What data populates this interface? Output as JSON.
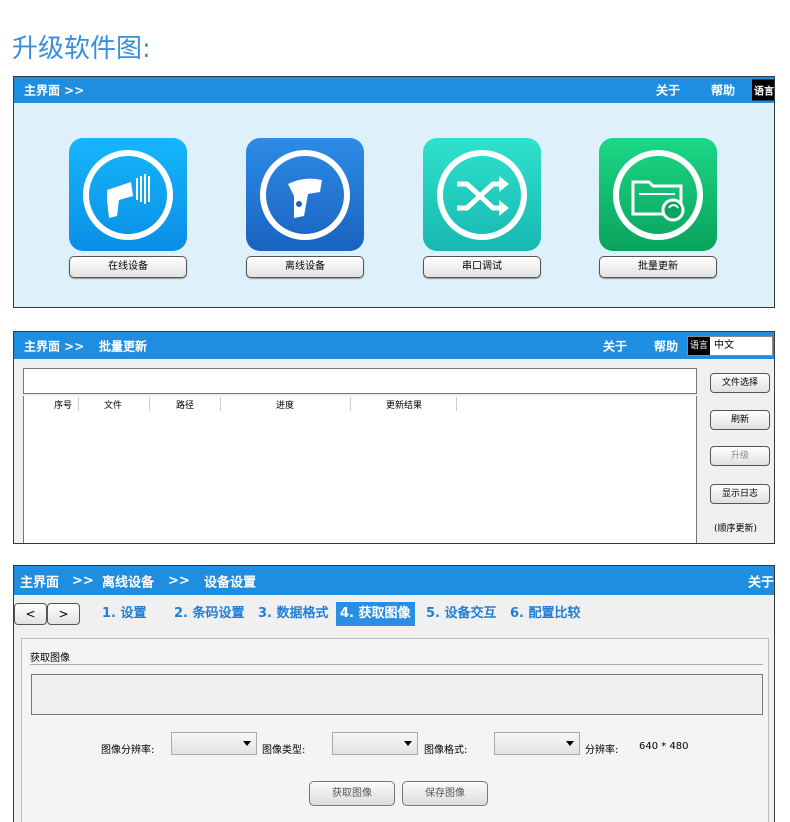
{
  "page_title": "升级软件图:",
  "panel1": {
    "header_left": "主界面 >>",
    "header_about": "关于",
    "header_help": "帮助",
    "header_lang": "语言",
    "apps": [
      {
        "label": "在线设备",
        "icon": "online-scanner-icon",
        "color_top": "#16b6fb",
        "color_bottom": "#0a8ee6"
      },
      {
        "label": "离线设备",
        "icon": "offline-scanner-icon",
        "color_top": "#2c8be6",
        "color_bottom": "#1a63c0"
      },
      {
        "label": "串口调试",
        "icon": "serial-shuffle-icon",
        "color_top": "#2fe2cd",
        "color_bottom": "#17b7b0"
      },
      {
        "label": "批量更新",
        "icon": "batch-update-folder-icon",
        "color_top": "#1cd787",
        "color_bottom": "#0aa25c"
      }
    ]
  },
  "panel2": {
    "header_left": "主界面 >>",
    "header_crumb": "批量更新",
    "header_about": "关于",
    "header_help": "帮助",
    "lang_label": "语言",
    "lang_value": "中文",
    "columns": [
      "序号",
      "文件",
      "路径",
      "进度",
      "更新结果"
    ],
    "buttons": {
      "choose_file": "文件选择",
      "refresh": "刷新",
      "upgrade": "升级",
      "show_log": "显示日志"
    },
    "sequence_note": "(顺序更新)"
  },
  "panel3": {
    "header_main": "主界面",
    "header_sep1": ">>",
    "header_offline": "离线设备",
    "header_sep2": ">>",
    "header_settings": "设备设置",
    "header_about": "关于",
    "nav_back": "<",
    "nav_forward": ">",
    "steps": [
      "1. 设置",
      "2. 条码设置",
      "3. 数据格式",
      "4. 获取图像",
      "5. 设备交互",
      "6. 配置比较"
    ],
    "section_title": "获取图像",
    "resolution_label": "图像分辨率:",
    "type_label": "图像类型:",
    "format_label": "图像格式:",
    "res_display_label": "分辨率:",
    "res_display_value": "640 * 480",
    "get_image_button": "获取图像",
    "save_image_button": "保存图像"
  },
  "colors": {
    "header_blue": "#1f8de0",
    "title_blue": "#3a8fdc",
    "panel1_bg": "#def1fb",
    "active_step": "#2a8fe4"
  }
}
